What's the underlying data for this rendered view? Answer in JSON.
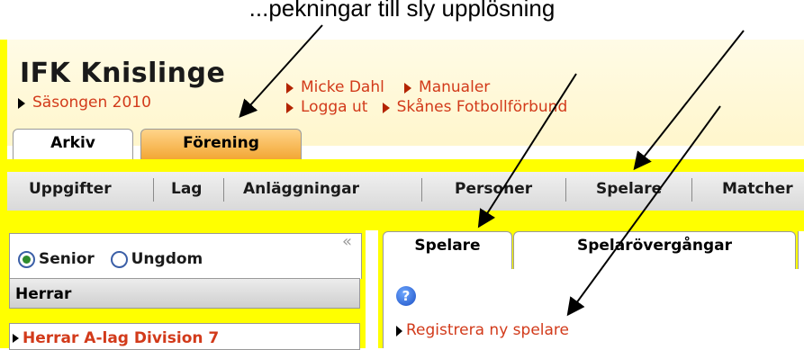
{
  "caption": "...pekningar till sly upplösning",
  "header": {
    "title": "IFK Knislinge",
    "season_link": "Säsongen 2010",
    "links_row1": [
      "Micke Dahl",
      "Manualer"
    ],
    "links_row2": [
      "Logga ut",
      "Skånes Fotbollförbund"
    ]
  },
  "tabs": [
    {
      "label": "Arkiv"
    },
    {
      "label": "Förening"
    }
  ],
  "nav": [
    "Uppgifter",
    "Lag",
    "Anläggningar",
    "Personer",
    "Spelare",
    "Matcher"
  ],
  "left_panel": {
    "radio_options": [
      "Senior",
      "Ungdom"
    ],
    "selected": "Senior",
    "collapse_symbol": "«",
    "section_header": "Herrar",
    "items": [
      "Herrar A-lag Division 7"
    ]
  },
  "right_panel": {
    "tabs": [
      "Spelare",
      "Spelarövergångar"
    ],
    "help_symbol": "?",
    "action_link": "Registrera ny spelare"
  },
  "colors": {
    "accent_yellow": "#ffff00",
    "link_red": "#d23a1a",
    "active_tab_orange": "#f2a531"
  }
}
